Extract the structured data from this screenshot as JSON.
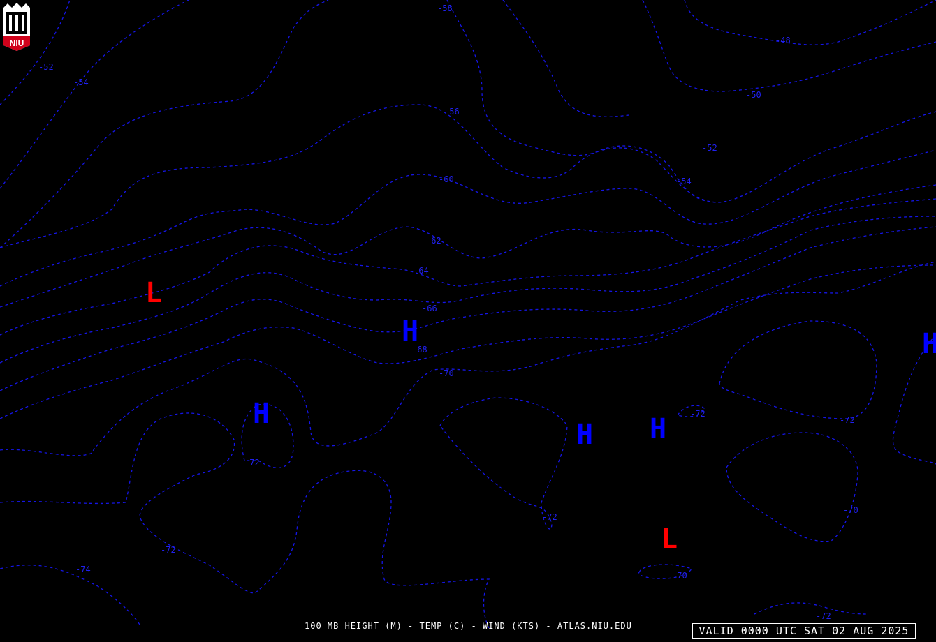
{
  "logo": {
    "text": "NIU",
    "icon": "niu-tower-logo"
  },
  "footer": {
    "caption": "100 MB HEIGHT (M) - TEMP (C) - WIND (KTS) - ATLAS.NIU.EDU"
  },
  "valid_time": "VALID 0000 UTC SAT 02 AUG 2025",
  "colors": {
    "background": "#000000",
    "isotherm": "#1515e6",
    "high": "#0000ff",
    "low": "#ff0000",
    "text": "#ffffff"
  },
  "isotherm_labels": [
    "-58",
    "-48",
    "-52",
    "-54",
    "-50",
    "-52",
    "-54",
    "-56",
    "-60",
    "-62",
    "-64",
    "-66",
    "-68",
    "-70",
    "-72",
    "-72",
    "-72",
    "-72",
    "-70",
    "-72",
    "-74",
    "-70",
    "-72"
  ],
  "pressure_centers": {
    "high_symbol": "H",
    "low_symbol": "L",
    "highs": [
      "H",
      "H",
      "H",
      "H",
      "H"
    ],
    "lows": [
      "L",
      "L"
    ]
  }
}
